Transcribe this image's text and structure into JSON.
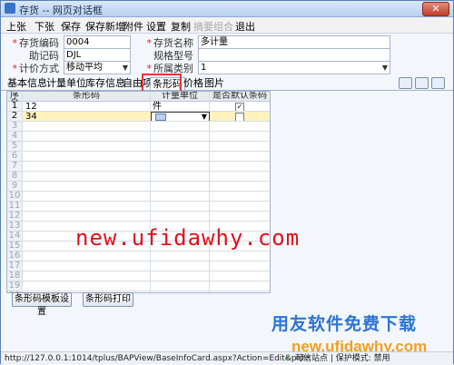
{
  "window": {
    "title": "存货 -- 网页对话框",
    "close": "✕"
  },
  "menu": [
    "上张",
    "下张",
    "保存",
    "保存新增",
    "附件",
    "设置",
    "复制",
    "摘要组合",
    "退出"
  ],
  "form": {
    "code_label": "存货编码",
    "code_value": "0004",
    "mnemonic_label": "助记码",
    "mnemonic_value": "DJL",
    "costing_label": "计价方式",
    "costing_value": "移动平均",
    "name_label": "存货名称",
    "name_value": "多计量",
    "spec_label": "规格型号",
    "spec_value": "",
    "category_label": "所属类别",
    "category_value": "1"
  },
  "tabs": [
    "基本信息",
    "计量单位",
    "库存信息",
    "自由项",
    "条形码",
    "价格",
    "图片"
  ],
  "active_tab": "条形码",
  "grid": {
    "columns": [
      "序号",
      "条形码",
      "计量单位",
      "是否默认条码"
    ],
    "rows": [
      {
        "no": "1",
        "barcode": "12",
        "unit": "件",
        "default": true
      },
      {
        "no": "2",
        "barcode": "34",
        "unit": "",
        "default": false
      }
    ],
    "empty_rows": [
      "3",
      "4",
      "5",
      "6",
      "7",
      "8",
      "9",
      "10",
      "11",
      "12",
      "13",
      "14",
      "15",
      "16",
      "17",
      "18",
      "19",
      "20"
    ]
  },
  "buttons": {
    "template": "条形码模板设置",
    "print": "条形码打印"
  },
  "watermark": "new.ufidawhy.com",
  "overlay": {
    "line1": "用友软件免费下载",
    "line2": "new.ufidawhy.com"
  },
  "status": {
    "url": "http://127.0.0.1:1014/tplus/BAPView/BaseInfoCard.aspx?Action=Edit&pId=",
    "zone": "可信站点 | 保护模式: 禁用"
  }
}
